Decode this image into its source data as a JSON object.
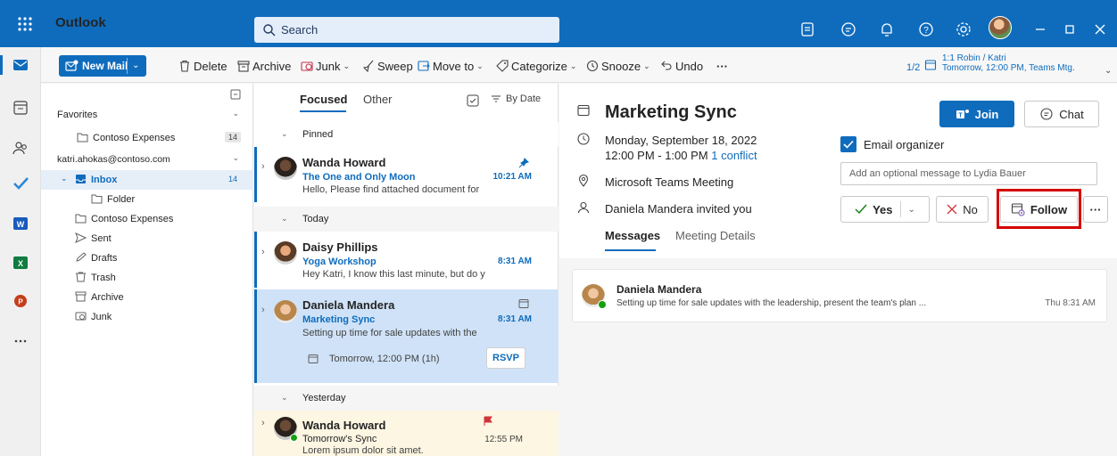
{
  "app": {
    "title": "Outlook"
  },
  "search": {
    "placeholder": "Search"
  },
  "ribbon": {
    "new_mail": "New Mail",
    "delete": "Delete",
    "archive": "Archive",
    "junk": "Junk",
    "sweep": "Sweep",
    "move_to": "Move to",
    "categorize": "Categorize",
    "snooze": "Snooze",
    "undo": "Undo",
    "more": "···"
  },
  "next_meeting": {
    "counter": "1/2",
    "title": "1:1 Robin / Katri",
    "detail": "Tomorrow, 12:00 PM, Teams Mtg."
  },
  "folders": {
    "favorites": "Favorites",
    "contoso_expenses_fav": "Contoso Expenses",
    "contoso_expenses_fav_count": "14",
    "account": "katri.ahokas@contoso.com",
    "inbox": "Inbox",
    "inbox_count": "14",
    "folder": "Folder",
    "contoso_expenses": "Contoso Expenses",
    "sent": "Sent",
    "drafts": "Drafts",
    "trash": "Trash",
    "archive": "Archive",
    "junk": "Junk"
  },
  "message_list": {
    "tab_focused": "Focused",
    "tab_other": "Other",
    "sort": "By Date",
    "sections": {
      "pinned": "Pinned",
      "today": "Today",
      "yesterday": "Yesterday"
    },
    "messages": [
      {
        "from": "Wanda Howard",
        "subject": "The One and Only Moon",
        "time": "10:21 AM",
        "preview": "Hello, Please find attached document for"
      },
      {
        "from": "Daisy Phillips",
        "subject": "Yoga Workshop",
        "time": "8:31 AM",
        "preview": "Hey Katri, I know this last minute, but do y"
      },
      {
        "from": "Daniela Mandera",
        "subject": "Marketing Sync",
        "time": "8:31 AM",
        "preview": "Setting up time for sale updates with the",
        "event": "Tomorrow, 12:00 PM (1h)",
        "rsvp": "RSVP"
      },
      {
        "from": "Wanda Howard",
        "subject": "Tomorrow's Sync",
        "time": "12:55 PM",
        "preview": "Lorem ipsum dolor sit amet."
      }
    ]
  },
  "event": {
    "title": "Marketing Sync",
    "date": "Monday, September 18, 2022",
    "time": "12:00 PM - 1:00 PM",
    "conflict": "1 conflict",
    "location": "Microsoft Teams Meeting",
    "invited": "Daniela Mandera invited you",
    "join": "Join",
    "chat": "Chat",
    "email_organizer": "Email organizer",
    "optional_message_placeholder": "Add an optional message to Lydia Bauer",
    "yes": "Yes",
    "no": "No",
    "follow": "Follow",
    "more": "···",
    "tab_messages": "Messages",
    "tab_details": "Meeting Details"
  },
  "thread": {
    "from": "Daniela Mandera",
    "preview": "Setting up time for sale updates with the leadership, present the team's plan ...",
    "time": "Thu 8:31 AM"
  },
  "colors": {
    "brand": "#0f6cbd",
    "highlight": "#d50000",
    "selected_row": "#cfe2f7",
    "flagged_row": "#fdf6e3"
  }
}
